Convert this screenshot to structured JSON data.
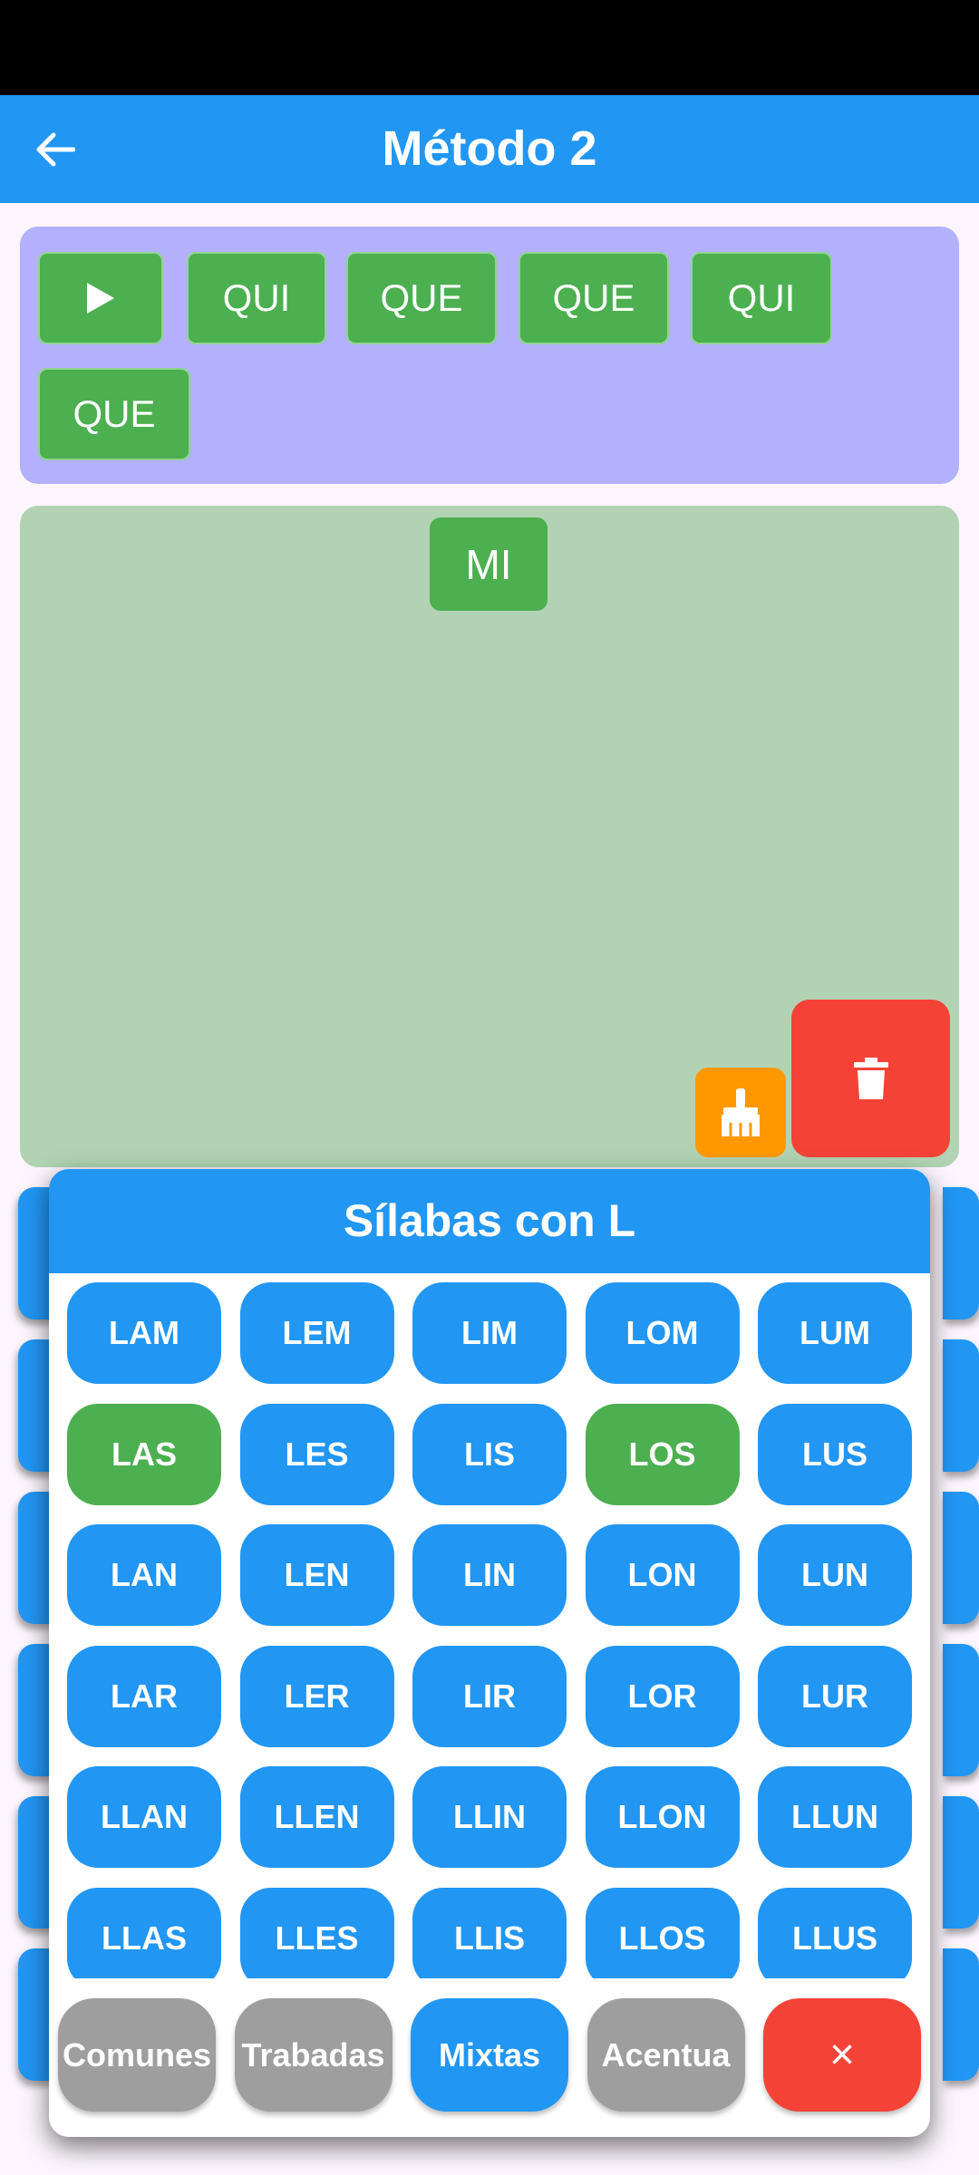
{
  "app_bar": {
    "title": "Método 2",
    "color": "#2196f3"
  },
  "sentence": {
    "play_icon": "play-icon",
    "chips": [
      "QUI",
      "QUE",
      "QUE",
      "QUI",
      "QUE"
    ]
  },
  "work_area": {
    "chips": [
      "MI"
    ]
  },
  "actions": {
    "clear_icon": "broom-icon",
    "delete_icon": "trash-icon"
  },
  "syllable_panel": {
    "title": "Sílabas con L",
    "rows": [
      [
        "LAM",
        "LEM",
        "LIM",
        "LOM",
        "LUM"
      ],
      [
        "LAS",
        "LES",
        "LIS",
        "LOS",
        "LUS"
      ],
      [
        "LAN",
        "LEN",
        "LIN",
        "LON",
        "LUN"
      ],
      [
        "LAR",
        "LER",
        "LIR",
        "LOR",
        "LUR"
      ],
      [
        "LLAN",
        "LLEN",
        "LLIN",
        "LLON",
        "LLUN"
      ],
      [
        "LLAS",
        "LLES",
        "LLIS",
        "LLOS",
        "LLUS"
      ]
    ],
    "selected": [
      "LAS",
      "LOS"
    ],
    "colors": {
      "default": "#2196f3",
      "selected": "#4caf50",
      "inactive_tab": "#9e9e9e",
      "close": "#f44336"
    }
  },
  "tabs": [
    {
      "label": "Comunes",
      "active": false
    },
    {
      "label": "Trabadas",
      "active": false
    },
    {
      "label": "Mixtas",
      "active": true
    },
    {
      "label": "Acentua",
      "active": false
    }
  ],
  "close_label": "×"
}
